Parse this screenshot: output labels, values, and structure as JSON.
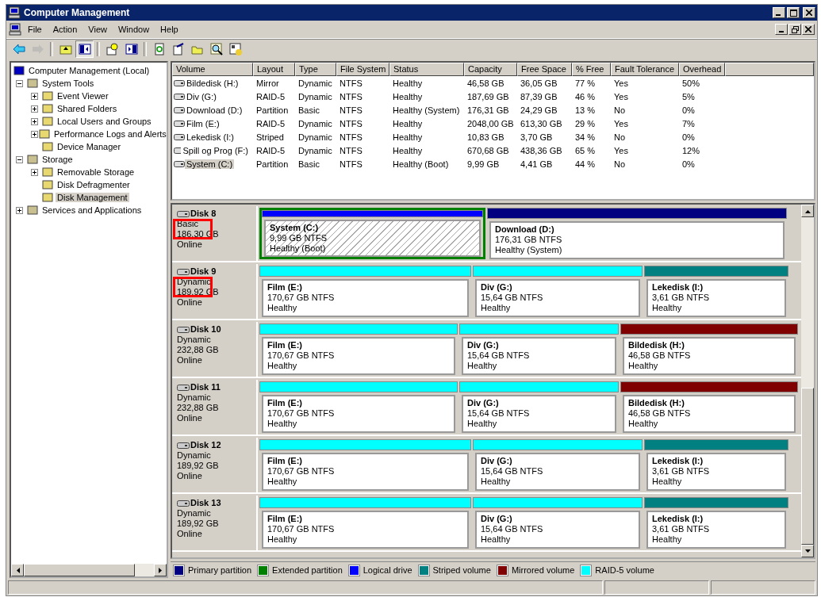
{
  "window": {
    "title": "Computer Management"
  },
  "menu": [
    "File",
    "Action",
    "View",
    "Window",
    "Help"
  ],
  "toolbar": [
    {
      "disabled": false,
      "pressed": false
    },
    {
      "disabled": true,
      "pressed": false
    },
    {
      "disabled": false,
      "pressed": false
    },
    {
      "disabled": false,
      "pressed": true
    },
    {
      "disabled": false,
      "pressed": false
    },
    {
      "disabled": false,
      "pressed": false
    },
    {
      "disabled": false,
      "pressed": false
    },
    {
      "disabled": false,
      "pressed": false
    },
    {
      "disabled": false,
      "pressed": false
    },
    {
      "disabled": false,
      "pressed": false
    },
    {
      "disabled": false,
      "pressed": false
    }
  ],
  "tree": [
    {
      "label": "Computer Management (Local)",
      "selected": false,
      "children": [
        {
          "label": "System Tools",
          "selected": false,
          "expanded": true,
          "children": [
            {
              "label": "Event Viewer",
              "selected": false,
              "expanded": false
            },
            {
              "label": "Shared Folders",
              "selected": false,
              "expanded": false
            },
            {
              "label": "Local Users and Groups",
              "selected": false,
              "expanded": false
            },
            {
              "label": "Performance Logs and Alerts",
              "selected": false,
              "expanded": false
            },
            {
              "label": "Device Manager",
              "selected": false
            }
          ]
        },
        {
          "label": "Storage",
          "selected": false,
          "expanded": true,
          "children": [
            {
              "label": "Removable Storage",
              "selected": false,
              "expanded": false
            },
            {
              "label": "Disk Defragmenter",
              "selected": false
            },
            {
              "label": "Disk Management",
              "selected": true
            }
          ]
        },
        {
          "label": "Services and Applications",
          "selected": false,
          "expanded": false
        }
      ]
    }
  ],
  "table": {
    "columns": [
      "Volume",
      "Layout",
      "Type",
      "File System",
      "Status",
      "Capacity",
      "Free Space",
      "% Free",
      "Fault Tolerance",
      "Overhead"
    ],
    "rows": [
      {
        "selected": false,
        "cells": [
          "Bildedisk (H:)",
          "Mirror",
          "Dynamic",
          "NTFS",
          "Healthy",
          "46,58 GB",
          "36,05 GB",
          "77 %",
          "Yes",
          "50%"
        ]
      },
      {
        "selected": false,
        "cells": [
          "Div (G:)",
          "RAID-5",
          "Dynamic",
          "NTFS",
          "Healthy",
          "187,69 GB",
          "87,39 GB",
          "46 %",
          "Yes",
          "5%"
        ]
      },
      {
        "selected": false,
        "cells": [
          "Download (D:)",
          "Partition",
          "Basic",
          "NTFS",
          "Healthy (System)",
          "176,31 GB",
          "24,29 GB",
          "13 %",
          "No",
          "0%"
        ]
      },
      {
        "selected": false,
        "cells": [
          "Film (E:)",
          "RAID-5",
          "Dynamic",
          "NTFS",
          "Healthy",
          "2048,00 GB",
          "613,30 GB",
          "29 %",
          "Yes",
          "7%"
        ]
      },
      {
        "selected": false,
        "cells": [
          "Lekedisk (I:)",
          "Striped",
          "Dynamic",
          "NTFS",
          "Healthy",
          "10,83 GB",
          "3,70 GB",
          "34 %",
          "No",
          "0%"
        ]
      },
      {
        "selected": false,
        "cells": [
          "Spill og Prog (F:)",
          "RAID-5",
          "Dynamic",
          "NTFS",
          "Healthy",
          "670,68 GB",
          "438,36 GB",
          "65 %",
          "Yes",
          "12%"
        ]
      },
      {
        "selected": true,
        "cells": [
          "System (C:)",
          "Partition",
          "Basic",
          "NTFS",
          "Healthy (Boot)",
          "9,99 GB",
          "4,41 GB",
          "44 %",
          "No",
          "0%"
        ]
      }
    ]
  },
  "disks": [
    {
      "name": "Disk 8",
      "type": "Basic",
      "capacity": "186,30 GB",
      "status": "Online",
      "highlighted": true,
      "partitions": [
        {
          "name": "System  (C:)",
          "size": "9,99 GB NTFS",
          "status": "Healthy (Boot)",
          "color": "#0000ff",
          "selected": true
        },
        {
          "name": "Download  (D:)",
          "size": "176,31 GB NTFS",
          "status": "Healthy (System)",
          "color": "#000080",
          "selected": false
        }
      ]
    },
    {
      "name": "Disk 9",
      "type": "Dynamic",
      "capacity": "189,92 GB",
      "status": "Online",
      "highlighted": true,
      "partitions": [
        {
          "name": "Film  (E:)",
          "size": "170,67 GB NTFS",
          "status": "Healthy",
          "color": "#00ffff",
          "selected": false
        },
        {
          "name": "Div  (G:)",
          "size": "15,64 GB NTFS",
          "status": "Healthy",
          "color": "#00ffff",
          "selected": false
        },
        {
          "name": "Lekedisk  (I:)",
          "size": "3,61 GB NTFS",
          "status": "Healthy",
          "color": "#008080",
          "selected": false
        }
      ]
    },
    {
      "name": "Disk 10",
      "type": "Dynamic",
      "capacity": "232,88 GB",
      "status": "Online",
      "highlighted": false,
      "partitions": [
        {
          "name": "Film  (E:)",
          "size": "170,67 GB NTFS",
          "status": "Healthy",
          "color": "#00ffff",
          "selected": false
        },
        {
          "name": "Div  (G:)",
          "size": "15,64 GB NTFS",
          "status": "Healthy",
          "color": "#00ffff",
          "selected": false
        },
        {
          "name": "Bildedisk  (H:)",
          "size": "46,58 GB NTFS",
          "status": "Healthy",
          "color": "#800000",
          "selected": false
        }
      ]
    },
    {
      "name": "Disk 11",
      "type": "Dynamic",
      "capacity": "232,88 GB",
      "status": "Online",
      "highlighted": false,
      "partitions": [
        {
          "name": "Film  (E:)",
          "size": "170,67 GB NTFS",
          "status": "Healthy",
          "color": "#00ffff",
          "selected": false
        },
        {
          "name": "Div  (G:)",
          "size": "15,64 GB NTFS",
          "status": "Healthy",
          "color": "#00ffff",
          "selected": false
        },
        {
          "name": "Bildedisk  (H:)",
          "size": "46,58 GB NTFS",
          "status": "Healthy",
          "color": "#800000",
          "selected": false
        }
      ]
    },
    {
      "name": "Disk 12",
      "type": "Dynamic",
      "capacity": "189,92 GB",
      "status": "Online",
      "highlighted": false,
      "partitions": [
        {
          "name": "Film  (E:)",
          "size": "170,67 GB NTFS",
          "status": "Healthy",
          "color": "#00ffff",
          "selected": false
        },
        {
          "name": "Div  (G:)",
          "size": "15,64 GB NTFS",
          "status": "Healthy",
          "color": "#00ffff",
          "selected": false
        },
        {
          "name": "Lekedisk  (I:)",
          "size": "3,61 GB NTFS",
          "status": "Healthy",
          "color": "#008080",
          "selected": false
        }
      ]
    },
    {
      "name": "Disk 13",
      "type": "Dynamic",
      "capacity": "189,92 GB",
      "status": "Online",
      "highlighted": false,
      "partitions": [
        {
          "name": "Film  (E:)",
          "size": "170,67 GB NTFS",
          "status": "Healthy",
          "color": "#00ffff",
          "selected": false
        },
        {
          "name": "Div  (G:)",
          "size": "15,64 GB NTFS",
          "status": "Healthy",
          "color": "#00ffff",
          "selected": false
        },
        {
          "name": "Lekedisk  (I:)",
          "size": "3,61 GB NTFS",
          "status": "Healthy",
          "color": "#008080",
          "selected": false
        }
      ]
    }
  ],
  "legend": [
    {
      "label": "Primary partition",
      "color": "#000080"
    },
    {
      "label": "Extended partition",
      "color": "#008000"
    },
    {
      "label": "Logical drive",
      "color": "#0000ff"
    },
    {
      "label": "Striped volume",
      "color": "#008080"
    },
    {
      "label": "Mirrored volume",
      "color": "#800000"
    },
    {
      "label": "RAID-5 volume",
      "color": "#00ffff"
    }
  ]
}
